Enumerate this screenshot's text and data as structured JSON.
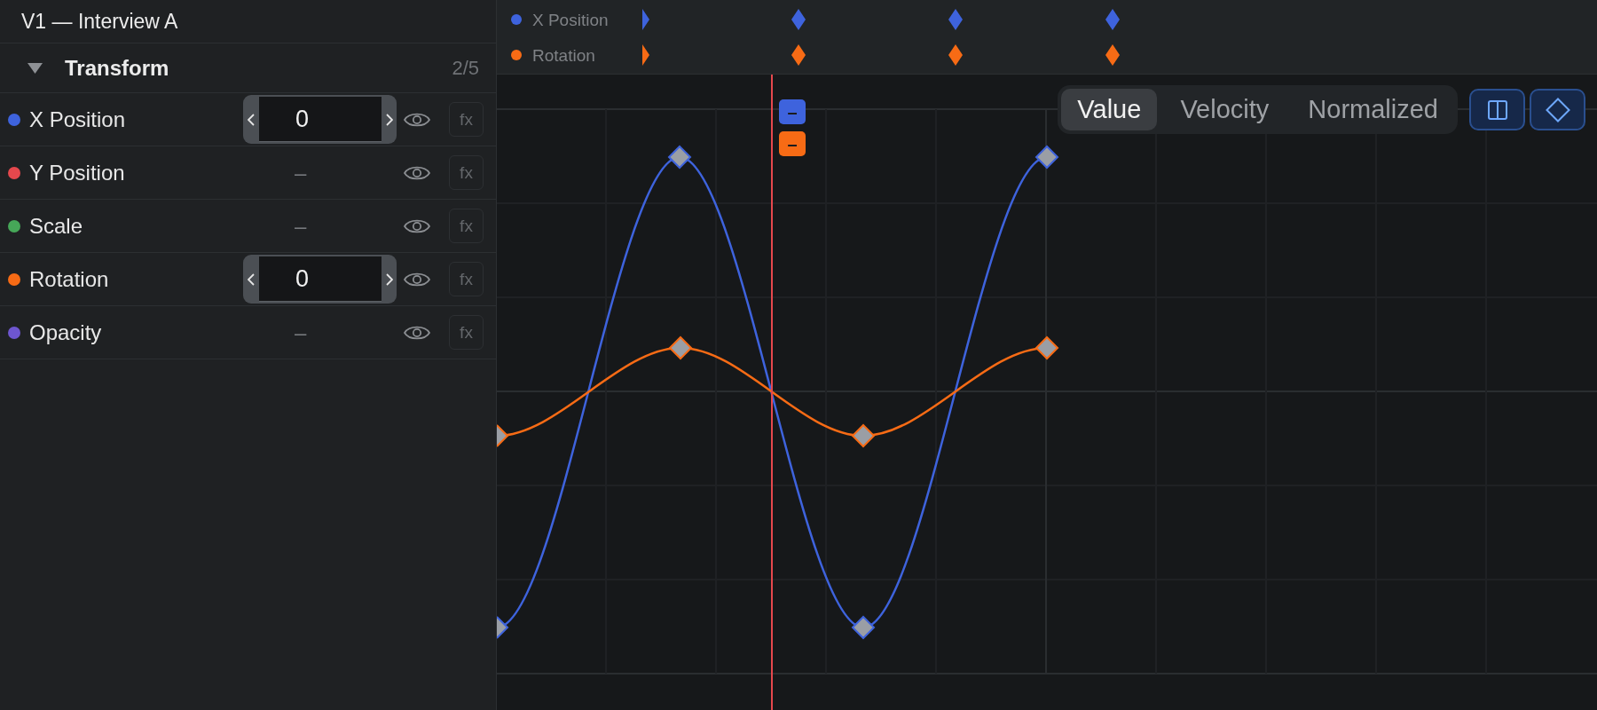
{
  "panel": {
    "title": "V1 — Interview A",
    "group": {
      "label": "Transform",
      "count": "2/5",
      "expanded": true
    },
    "properties": [
      {
        "label": "X Position",
        "color": "#3e63dd",
        "kind": "stepper",
        "value": "0",
        "visible": true,
        "fx": {
          "label": "fx",
          "disabled": true
        }
      },
      {
        "label": "Y Position",
        "color": "#e5484d",
        "kind": "empty",
        "value": "–",
        "visible": true,
        "fx": {
          "label": "fx",
          "disabled": true
        }
      },
      {
        "label": "Scale",
        "color": "#46a758",
        "kind": "empty",
        "value": "–",
        "visible": true,
        "fx": {
          "label": "fx",
          "disabled": true
        }
      },
      {
        "label": "Rotation",
        "color": "#f76b15",
        "kind": "stepper",
        "value": "0",
        "visible": true,
        "fx": {
          "label": "fx",
          "disabled": true
        }
      },
      {
        "label": "Opacity",
        "color": "#6e56cf",
        "kind": "empty",
        "value": "–",
        "visible": true,
        "fx": {
          "label": "fx",
          "disabled": true
        }
      }
    ]
  },
  "timeline": {
    "tracks": [
      {
        "label": "X Position",
        "color": "#3e63dd",
        "badge": "–"
      },
      {
        "label": "Rotation",
        "color": "#f76b15",
        "badge": "–"
      }
    ]
  },
  "graph": {
    "modes": [
      {
        "label": "Value",
        "selected": true
      },
      {
        "label": "Velocity",
        "selected": false
      },
      {
        "label": "Normalized",
        "selected": false
      }
    ],
    "toggles": [
      {
        "kind": "split",
        "on": true
      },
      {
        "kind": "keyframe",
        "on": true
      }
    ]
  }
}
